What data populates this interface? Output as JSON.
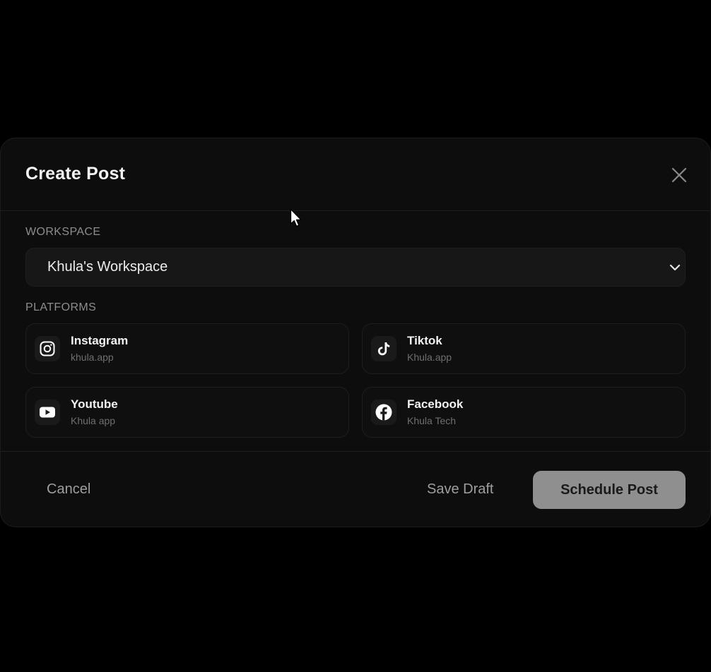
{
  "modal": {
    "title": "Create Post"
  },
  "workspace": {
    "label": "WORKSPACE",
    "selected": "Khula's Workspace"
  },
  "platforms": {
    "label": "PLATFORMS",
    "items": [
      {
        "name": "Instagram",
        "account": "khula.app",
        "icon": "instagram-icon"
      },
      {
        "name": "Tiktok",
        "account": "Khula.app",
        "icon": "tiktok-icon"
      },
      {
        "name": "Youtube",
        "account": "Khula app",
        "icon": "youtube-icon"
      },
      {
        "name": "Facebook",
        "account": "Khula Tech",
        "icon": "facebook-icon"
      }
    ]
  },
  "footer": {
    "cancel_label": "Cancel",
    "save_draft_label": "Save Draft",
    "schedule_label": "Schedule Post"
  },
  "colors": {
    "background": "#000000",
    "modal": "#0d0d0d",
    "primary_button": "#8f8f8f",
    "text": "#f2f2f2",
    "muted": "#8d8d8d"
  }
}
